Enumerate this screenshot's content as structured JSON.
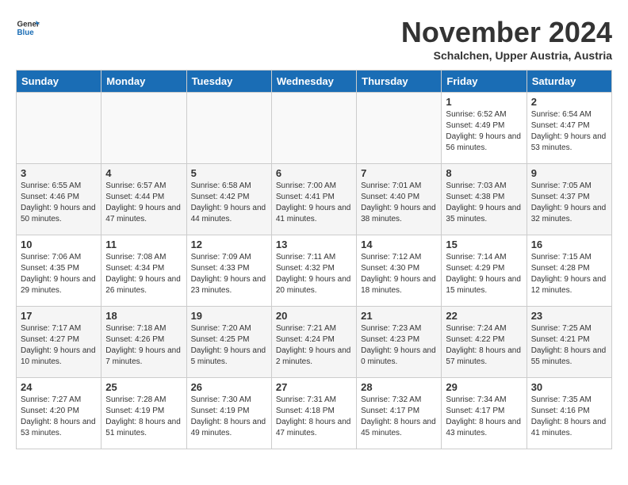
{
  "logo": {
    "text_general": "General",
    "text_blue": "Blue"
  },
  "title": "November 2024",
  "subtitle": "Schalchen, Upper Austria, Austria",
  "days_of_week": [
    "Sunday",
    "Monday",
    "Tuesday",
    "Wednesday",
    "Thursday",
    "Friday",
    "Saturday"
  ],
  "weeks": [
    [
      {
        "day": "",
        "info": "",
        "empty": true
      },
      {
        "day": "",
        "info": "",
        "empty": true
      },
      {
        "day": "",
        "info": "",
        "empty": true
      },
      {
        "day": "",
        "info": "",
        "empty": true
      },
      {
        "day": "",
        "info": "",
        "empty": true
      },
      {
        "day": "1",
        "info": "Sunrise: 6:52 AM\nSunset: 4:49 PM\nDaylight: 9 hours and 56 minutes."
      },
      {
        "day": "2",
        "info": "Sunrise: 6:54 AM\nSunset: 4:47 PM\nDaylight: 9 hours and 53 minutes."
      }
    ],
    [
      {
        "day": "3",
        "info": "Sunrise: 6:55 AM\nSunset: 4:46 PM\nDaylight: 9 hours and 50 minutes."
      },
      {
        "day": "4",
        "info": "Sunrise: 6:57 AM\nSunset: 4:44 PM\nDaylight: 9 hours and 47 minutes."
      },
      {
        "day": "5",
        "info": "Sunrise: 6:58 AM\nSunset: 4:42 PM\nDaylight: 9 hours and 44 minutes."
      },
      {
        "day": "6",
        "info": "Sunrise: 7:00 AM\nSunset: 4:41 PM\nDaylight: 9 hours and 41 minutes."
      },
      {
        "day": "7",
        "info": "Sunrise: 7:01 AM\nSunset: 4:40 PM\nDaylight: 9 hours and 38 minutes."
      },
      {
        "day": "8",
        "info": "Sunrise: 7:03 AM\nSunset: 4:38 PM\nDaylight: 9 hours and 35 minutes."
      },
      {
        "day": "9",
        "info": "Sunrise: 7:05 AM\nSunset: 4:37 PM\nDaylight: 9 hours and 32 minutes."
      }
    ],
    [
      {
        "day": "10",
        "info": "Sunrise: 7:06 AM\nSunset: 4:35 PM\nDaylight: 9 hours and 29 minutes."
      },
      {
        "day": "11",
        "info": "Sunrise: 7:08 AM\nSunset: 4:34 PM\nDaylight: 9 hours and 26 minutes."
      },
      {
        "day": "12",
        "info": "Sunrise: 7:09 AM\nSunset: 4:33 PM\nDaylight: 9 hours and 23 minutes."
      },
      {
        "day": "13",
        "info": "Sunrise: 7:11 AM\nSunset: 4:32 PM\nDaylight: 9 hours and 20 minutes."
      },
      {
        "day": "14",
        "info": "Sunrise: 7:12 AM\nSunset: 4:30 PM\nDaylight: 9 hours and 18 minutes."
      },
      {
        "day": "15",
        "info": "Sunrise: 7:14 AM\nSunset: 4:29 PM\nDaylight: 9 hours and 15 minutes."
      },
      {
        "day": "16",
        "info": "Sunrise: 7:15 AM\nSunset: 4:28 PM\nDaylight: 9 hours and 12 minutes."
      }
    ],
    [
      {
        "day": "17",
        "info": "Sunrise: 7:17 AM\nSunset: 4:27 PM\nDaylight: 9 hours and 10 minutes."
      },
      {
        "day": "18",
        "info": "Sunrise: 7:18 AM\nSunset: 4:26 PM\nDaylight: 9 hours and 7 minutes."
      },
      {
        "day": "19",
        "info": "Sunrise: 7:20 AM\nSunset: 4:25 PM\nDaylight: 9 hours and 5 minutes."
      },
      {
        "day": "20",
        "info": "Sunrise: 7:21 AM\nSunset: 4:24 PM\nDaylight: 9 hours and 2 minutes."
      },
      {
        "day": "21",
        "info": "Sunrise: 7:23 AM\nSunset: 4:23 PM\nDaylight: 9 hours and 0 minutes."
      },
      {
        "day": "22",
        "info": "Sunrise: 7:24 AM\nSunset: 4:22 PM\nDaylight: 8 hours and 57 minutes."
      },
      {
        "day": "23",
        "info": "Sunrise: 7:25 AM\nSunset: 4:21 PM\nDaylight: 8 hours and 55 minutes."
      }
    ],
    [
      {
        "day": "24",
        "info": "Sunrise: 7:27 AM\nSunset: 4:20 PM\nDaylight: 8 hours and 53 minutes."
      },
      {
        "day": "25",
        "info": "Sunrise: 7:28 AM\nSunset: 4:19 PM\nDaylight: 8 hours and 51 minutes."
      },
      {
        "day": "26",
        "info": "Sunrise: 7:30 AM\nSunset: 4:19 PM\nDaylight: 8 hours and 49 minutes."
      },
      {
        "day": "27",
        "info": "Sunrise: 7:31 AM\nSunset: 4:18 PM\nDaylight: 8 hours and 47 minutes."
      },
      {
        "day": "28",
        "info": "Sunrise: 7:32 AM\nSunset: 4:17 PM\nDaylight: 8 hours and 45 minutes."
      },
      {
        "day": "29",
        "info": "Sunrise: 7:34 AM\nSunset: 4:17 PM\nDaylight: 8 hours and 43 minutes."
      },
      {
        "day": "30",
        "info": "Sunrise: 7:35 AM\nSunset: 4:16 PM\nDaylight: 8 hours and 41 minutes."
      }
    ]
  ]
}
